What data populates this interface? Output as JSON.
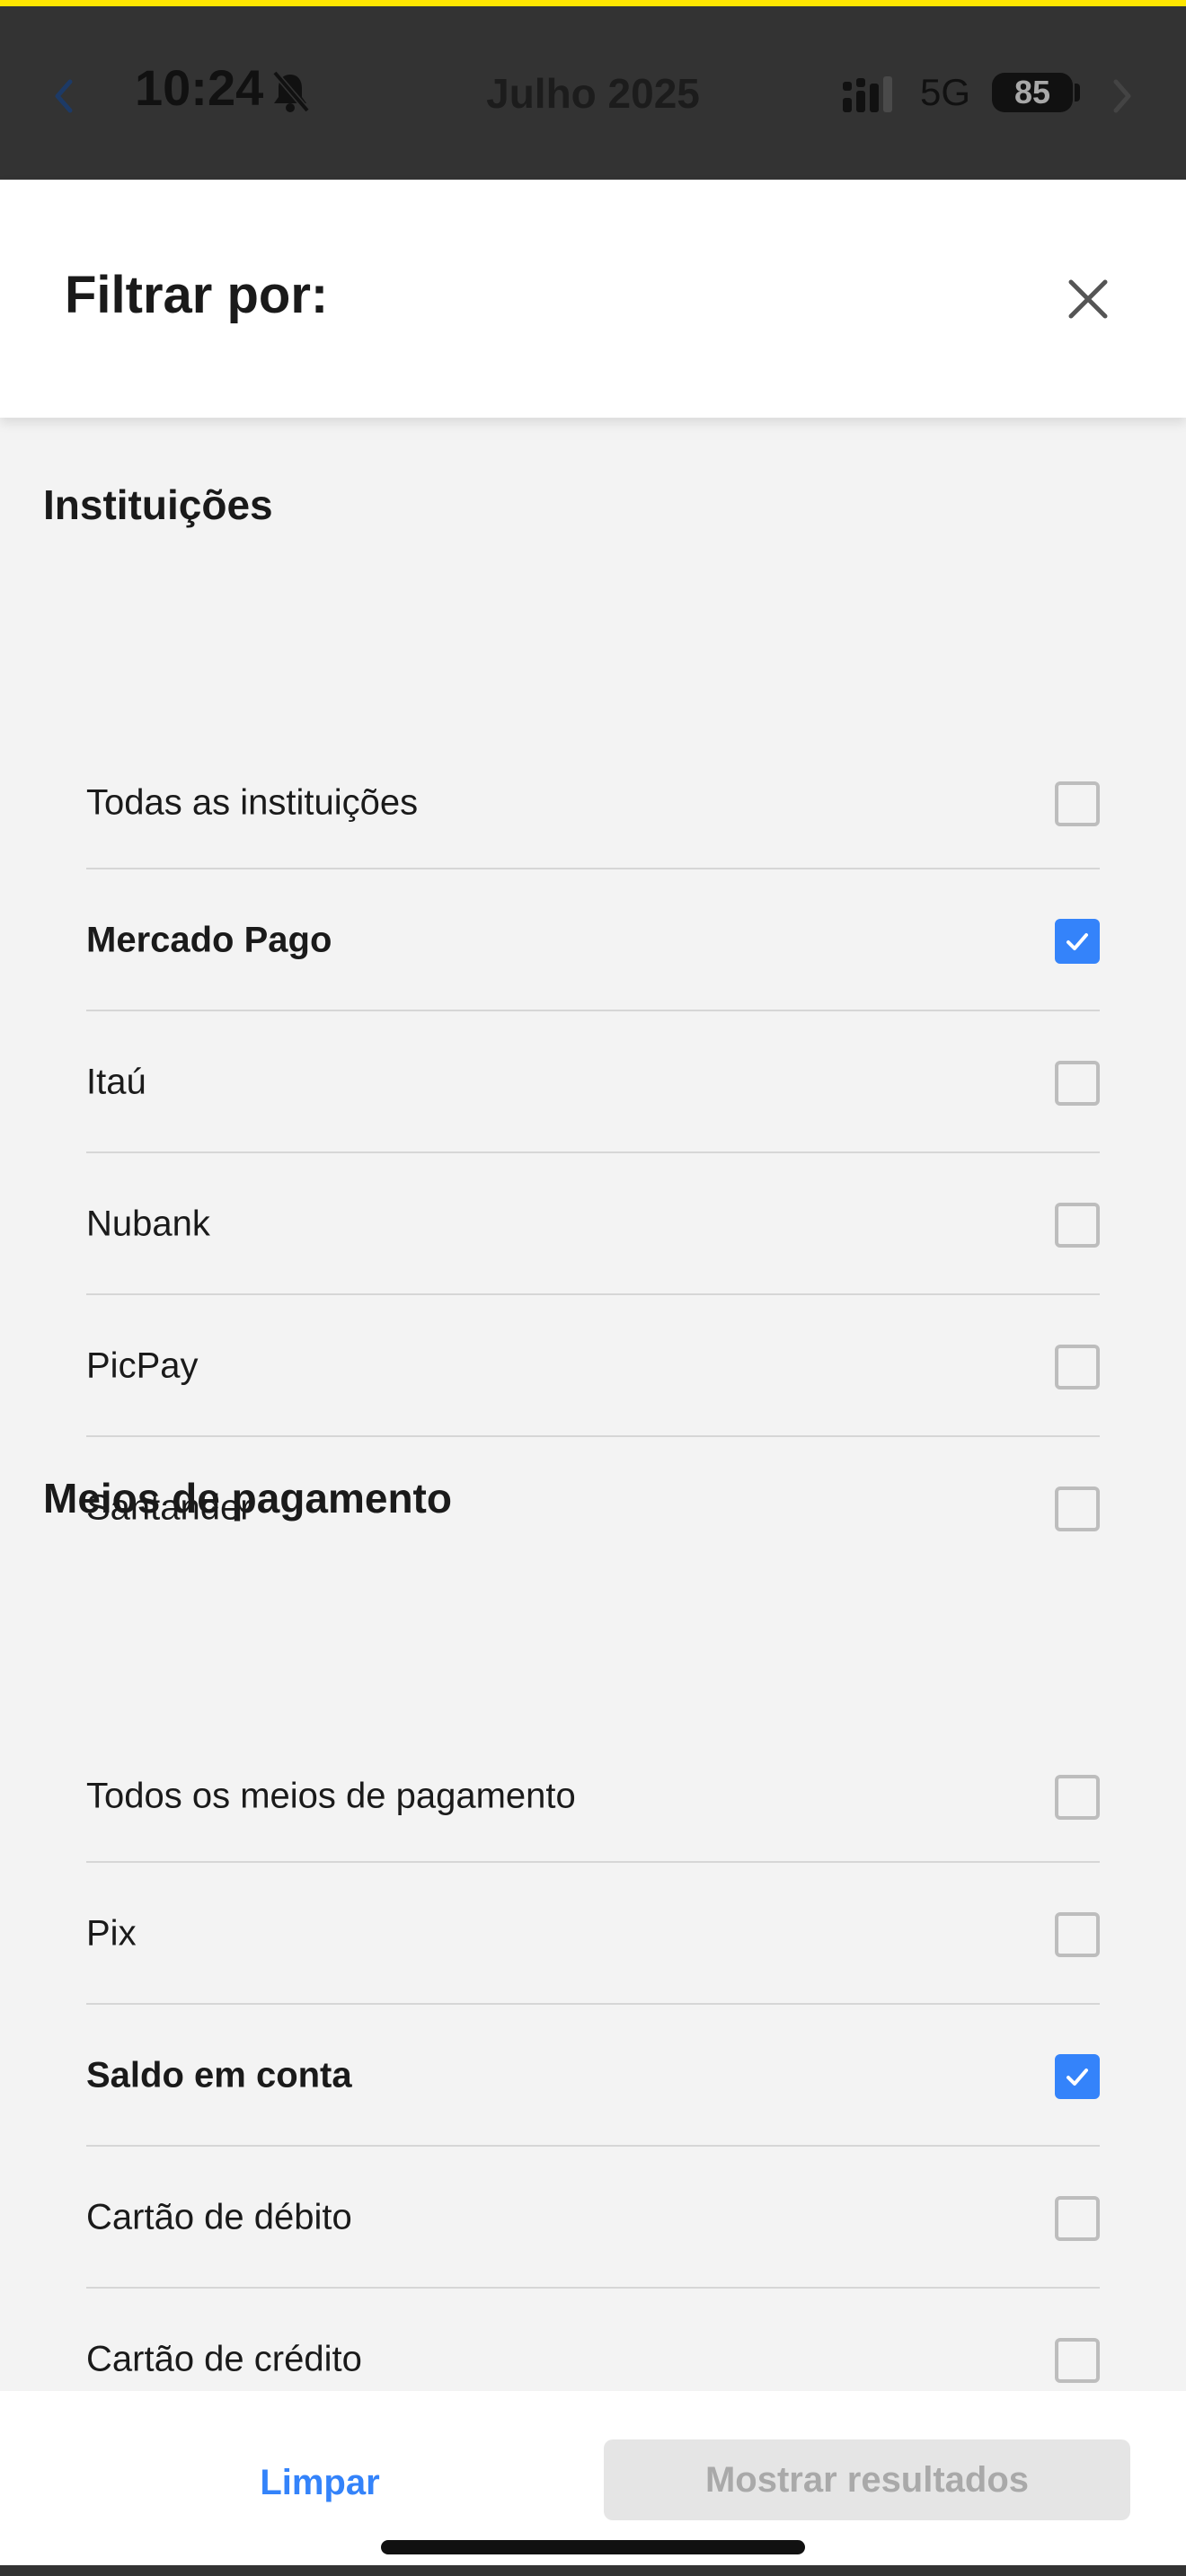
{
  "status_bar": {
    "time": "10:24",
    "month_label": "Julho 2025",
    "network": "5G",
    "battery": "85",
    "icons": [
      "back-chevron-icon",
      "bell-slash-icon",
      "signal-icon",
      "battery-icon",
      "forward-chevron-icon"
    ]
  },
  "sheet": {
    "title": "Filtrar por:",
    "close_icon": "close-icon"
  },
  "institutions": {
    "title": "Instituições",
    "options": [
      {
        "label": "Todas as instituições",
        "checked": false
      },
      {
        "label": "Mercado Pago",
        "checked": true
      },
      {
        "label": "Itaú",
        "checked": false
      },
      {
        "label": "Nubank",
        "checked": false
      },
      {
        "label": "PicPay",
        "checked": false
      },
      {
        "label": "Santander",
        "checked": false
      }
    ]
  },
  "payment_methods": {
    "title": "Meios de pagamento",
    "options": [
      {
        "label": "Todos os meios de pagamento",
        "checked": false
      },
      {
        "label": "Pix",
        "checked": false
      },
      {
        "label": "Saldo em conta",
        "checked": true
      },
      {
        "label": "Cartão de débito",
        "checked": false
      },
      {
        "label": "Cartão de crédito",
        "checked": false
      }
    ]
  },
  "footer": {
    "clear_label": "Limpar",
    "show_results_label": "Mostrar resultados"
  },
  "colors": {
    "accent": "#3483fa",
    "brand_yellow": "#ffe600",
    "overlay": "#333333"
  }
}
